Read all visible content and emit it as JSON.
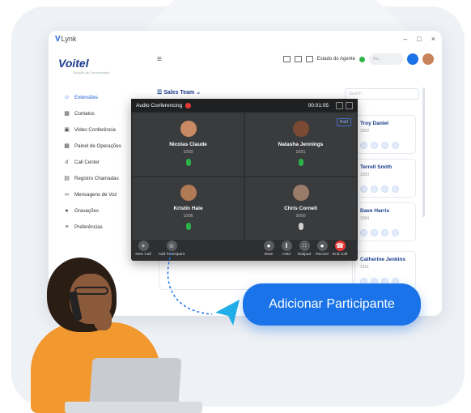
{
  "window": {
    "app_name": "Lynk",
    "logo_letter": "V",
    "controls": [
      "–",
      "□",
      "×"
    ]
  },
  "brand": {
    "name": "Voitel",
    "tagline": "Solução de Comunicação"
  },
  "sidebar": {
    "items": [
      {
        "label": "Extensões",
        "icon": "users-icon",
        "active": true
      },
      {
        "label": "Contatos",
        "icon": "contacts-icon",
        "active": false
      },
      {
        "label": "Video Conferência",
        "icon": "video-icon",
        "active": false
      },
      {
        "label": "Painel de Operações",
        "icon": "dashboard-icon",
        "active": false
      },
      {
        "label": "Call Center",
        "icon": "headset-icon",
        "active": false
      },
      {
        "label": "Registro Chamadas",
        "icon": "call-log-icon",
        "active": false
      },
      {
        "label": "Mensagens de Voz",
        "icon": "voicemail-icon",
        "active": false
      },
      {
        "label": "Gravações",
        "icon": "microphone-icon",
        "active": false
      },
      {
        "label": "Preferências",
        "icon": "settings-icon",
        "active": false
      }
    ]
  },
  "topbar": {
    "agent_status": "Estado do Agente",
    "status_pill": "No...",
    "status_color": "#2db24a"
  },
  "team": {
    "label": "Sales Team"
  },
  "search": {
    "placeholder": "Search"
  },
  "contacts": [
    {
      "name": "Troy Daniel",
      "ext": "1002"
    },
    {
      "name": "Terrell Smith",
      "ext": "1003"
    },
    {
      "name": "Dave Harris",
      "ext": "1004"
    },
    {
      "name": "Catherine Jenkins",
      "ext": "1011"
    }
  ],
  "conference": {
    "title": "Audio Conferencing",
    "timer": "00:01:05",
    "hold_label": "Hold",
    "participants": [
      {
        "name": "Nicolas Claude",
        "ext": "1000",
        "muted": false,
        "avatar": "#c98a63"
      },
      {
        "name": "Natasha Jennings",
        "ext": "1001",
        "muted": false,
        "avatar": "#7a4a33"
      },
      {
        "name": "Kristin Hale",
        "ext": "1006",
        "muted": false,
        "avatar": "#b07a55"
      },
      {
        "name": "Chris Cornell",
        "ext": "2000",
        "muted": true,
        "avatar": "#9b7b6a"
      }
    ],
    "toolbar": {
      "new_call": "New Call",
      "add_participant": "Add Participant",
      "mute": "Mute",
      "hold": "Hold",
      "dialpad": "Dialpad",
      "record": "Record",
      "end_call": "End Call"
    }
  },
  "cta": {
    "label": "Adicionar Participante",
    "color": "#1a73e8"
  }
}
